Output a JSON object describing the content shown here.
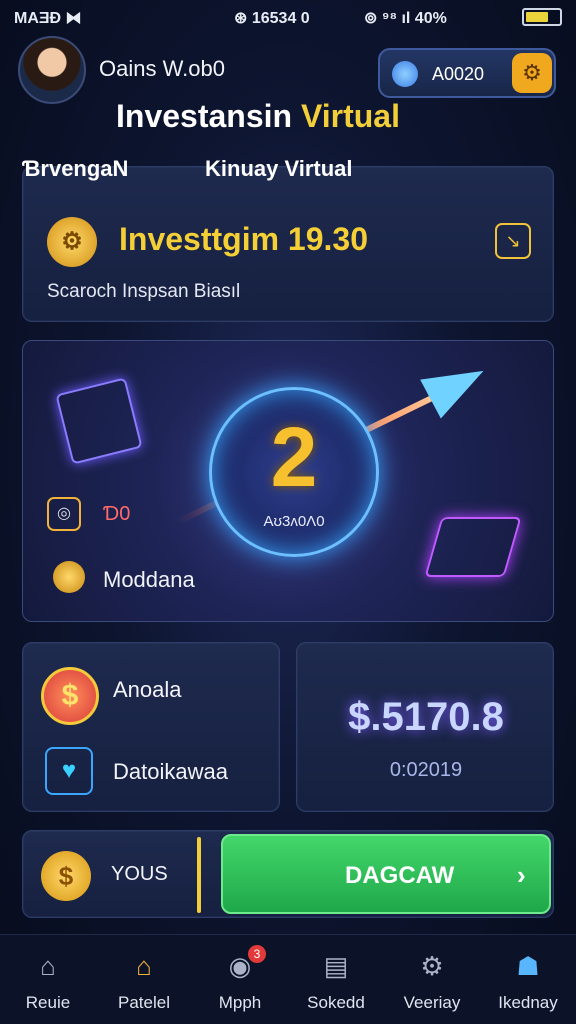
{
  "status_bar": {
    "left": "MAƎÐ ⧓",
    "center": "⊛ 16534 0",
    "right": "⊚ ⁹⁸ ıl 40%"
  },
  "profile": {
    "name": "Oains W.ob0"
  },
  "balance": {
    "value": "A0020"
  },
  "app_title": {
    "main": "Investansin",
    "accent": "Virtual"
  },
  "labels": {
    "left": "ƁrvengaN",
    "right": "Kinuay Virtual"
  },
  "invest_card": {
    "amount": "Investtgim 19.30",
    "subtitle": "Scaroch Inspsan Biasıl"
  },
  "hero": {
    "number": "2",
    "ring_label": "Aʊ3ʌ0Λ0",
    "stat_value": "Ɗ0",
    "stat_label": "Moddana"
  },
  "left_card": {
    "row1": "Anoala",
    "row2": "Datoikawaa"
  },
  "right_card": {
    "amount": "$.5170.8",
    "time": "0:02019"
  },
  "bottom_bar": {
    "label": "YOUS",
    "cta": "DAGCAW"
  },
  "nav": [
    {
      "label": "Reuie",
      "icon": "home-icon"
    },
    {
      "label": "Patelel",
      "icon": "house-icon"
    },
    {
      "label": "Mpph",
      "icon": "globe-icon",
      "badge": "3"
    },
    {
      "label": "Sokedd",
      "icon": "chart-icon"
    },
    {
      "label": "Veeriay",
      "icon": "gear-icon"
    },
    {
      "label": "Ikednay",
      "icon": "user-icon"
    }
  ],
  "colors": {
    "accent": "#f2cf3a",
    "cta": "#2fbf55",
    "bg": "#0a1124"
  }
}
